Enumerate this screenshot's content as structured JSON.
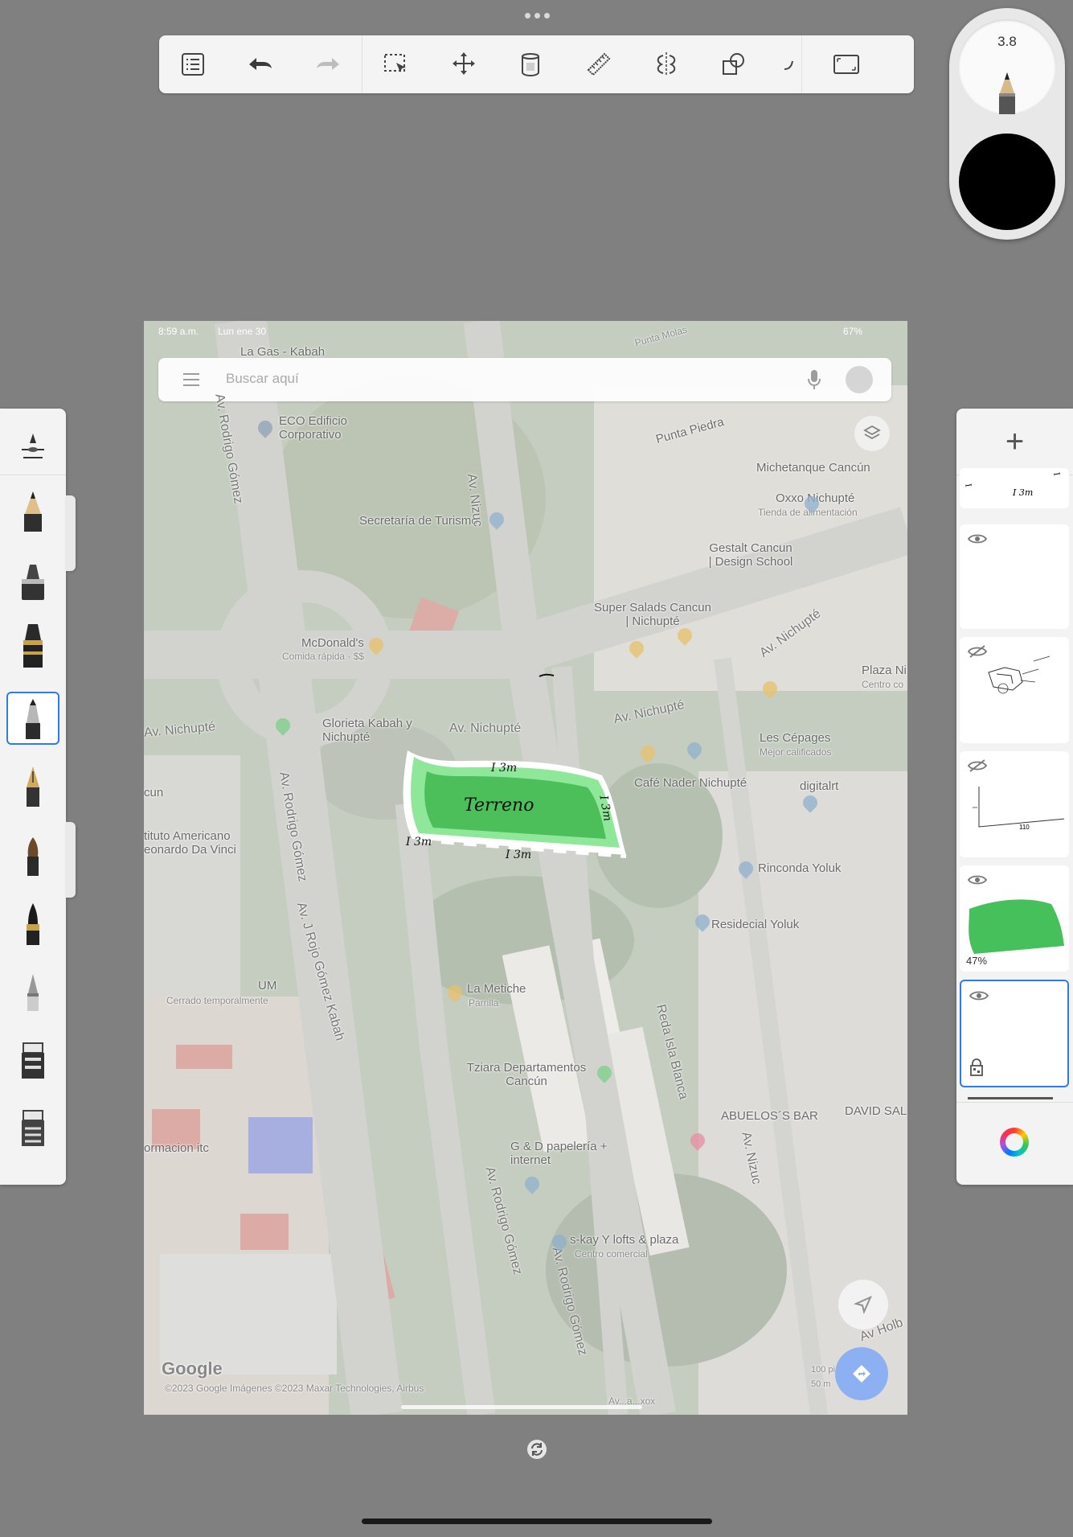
{
  "toolbar": {
    "buttons": [
      {
        "name": "layers-list-button",
        "icon": "list-icon"
      },
      {
        "name": "undo-button",
        "icon": "undo-icon"
      },
      {
        "name": "redo-button",
        "icon": "redo-icon"
      },
      {
        "name": "selection-button",
        "icon": "selection-icon"
      },
      {
        "name": "transform-button",
        "icon": "move-icon"
      },
      {
        "name": "fill-button",
        "icon": "paint-bucket-icon"
      },
      {
        "name": "ruler-button",
        "icon": "ruler-icon"
      },
      {
        "name": "symmetry-button",
        "icon": "symmetry-icon"
      },
      {
        "name": "shapes-button",
        "icon": "shapes-icon"
      },
      {
        "name": "more-button",
        "icon": "curve-icon"
      },
      {
        "name": "fullscreen-button",
        "icon": "fullscreen-icon"
      }
    ]
  },
  "brush_puck": {
    "size_value": "3.8",
    "color": "#000000"
  },
  "canvas": {
    "status_bar": {
      "time": "8:59 a.m.",
      "date": "Lun ene 30",
      "battery": "67%"
    },
    "search": {
      "placeholder": "Buscar aquí"
    },
    "map_labels": {
      "la_gas": "La Gas - Kabah",
      "punta_molas": "Punta Molas",
      "eco_edificio": "ECO Edificio Corporativo",
      "punta_piedra": "Punta Piedra",
      "michetanque": "Michetanque Cancún",
      "oxxo": "Oxxo Nichupté",
      "oxxo_sub": "Tienda de alimentación",
      "secretaria": "Secretaría de Turismo",
      "gestalt": "Gestalt Cancun | Design School",
      "super_salads": "Super Salads Cancun | Nichupté",
      "mcdonalds": "McDonald's",
      "mcdonalds_sub": "Comida rápida · $$",
      "plaza": "Plaza Ni",
      "plaza_sub": "Centro co",
      "glorieta": "Glorieta Kabah y Nichupté",
      "av_nichupte_1": "Av. Nichupté",
      "av_nichupte_2": "Av. Nichupté",
      "av_nichupte_3": "Av. Nichupté",
      "av_nichupte_left": "Av. Nichupté",
      "les_cepages": "Les Cépages",
      "les_cepages_sub": "Mejor calificados",
      "cafe_nader": "Café Nader Nichupté",
      "digitalrt": "digitalrt",
      "cun": "cun",
      "instituto": "tituto Americano eonardo Da Vinci",
      "rinconada": "Rinconda Yoluk",
      "residencial": "Residecial Yoluk",
      "um": "UM",
      "um_sub": "Cerrado temporalmente",
      "la_metiche": "La Metiche",
      "la_metiche_sub": "Parrilla",
      "tziara": "Tziara Departamentos Cancún",
      "abuelos": "ABUELOS´S BAR",
      "david": "DAVID SAL",
      "formacion": "ormacion itc",
      "g_d": "G & D papelería + internet",
      "sky_lofts": "s-kay Y lofts & plaza",
      "sky_lofts_sub": "Centro comercial",
      "av_rodrigo_1": "Av. Rodrigo Gómez",
      "av_rodrigo_2": "Av. Rodrigo Gómez",
      "av_rodrigo_3": "Av. Rodrigo Gómez",
      "av_rodrigo_4": "Av. Rodrigo Gómez",
      "av_rojo": "Av. J Rojo Gómez Kabah",
      "av_nizuc_1": "Av. Nizuc",
      "av_nizuc_2": "Av. Nizuc",
      "reda": "Reda Isla Blanca",
      "av_holb": "Av Holb",
      "google": "Google",
      "copyright": "©2023 Google Imágenes ©2023 Maxar Technologies, Airbus",
      "scale": "100 pies",
      "scale_m": "50 m",
      "bottom_partial": "Av...a...xox"
    },
    "annotations": {
      "terreno": "Terreno",
      "dim_top": "I 3m",
      "dim_right": "I 3m",
      "dim_left": "I 3m",
      "dim_bottom": "I 3m"
    }
  },
  "brush_panel": {
    "brushes": [
      "brush-settings",
      "pencil",
      "marker",
      "fountain-pen",
      "technical-pen",
      "calligraphy-pen",
      "paint-brush",
      "ink-brush",
      "airbrush",
      "eraser",
      "soft-eraser"
    ],
    "active_index": 4
  },
  "layers_panel": {
    "add_label": "+",
    "layers": [
      {
        "name": "layer-dimensions",
        "visible": true,
        "text": "I 3m"
      },
      {
        "name": "layer-empty",
        "visible": true
      },
      {
        "name": "layer-sketch",
        "visible": false
      },
      {
        "name": "layer-axes",
        "visible": false,
        "text": "110"
      },
      {
        "name": "layer-green-fill",
        "visible": true,
        "opacity": "47%"
      },
      {
        "name": "layer-map",
        "visible": true,
        "locked": true,
        "selected": true
      }
    ]
  },
  "colors": {
    "background": "#808080",
    "accent": "#2d7bf0",
    "green_fill": "#4cbf5a",
    "light_green": "#8fe79a"
  }
}
